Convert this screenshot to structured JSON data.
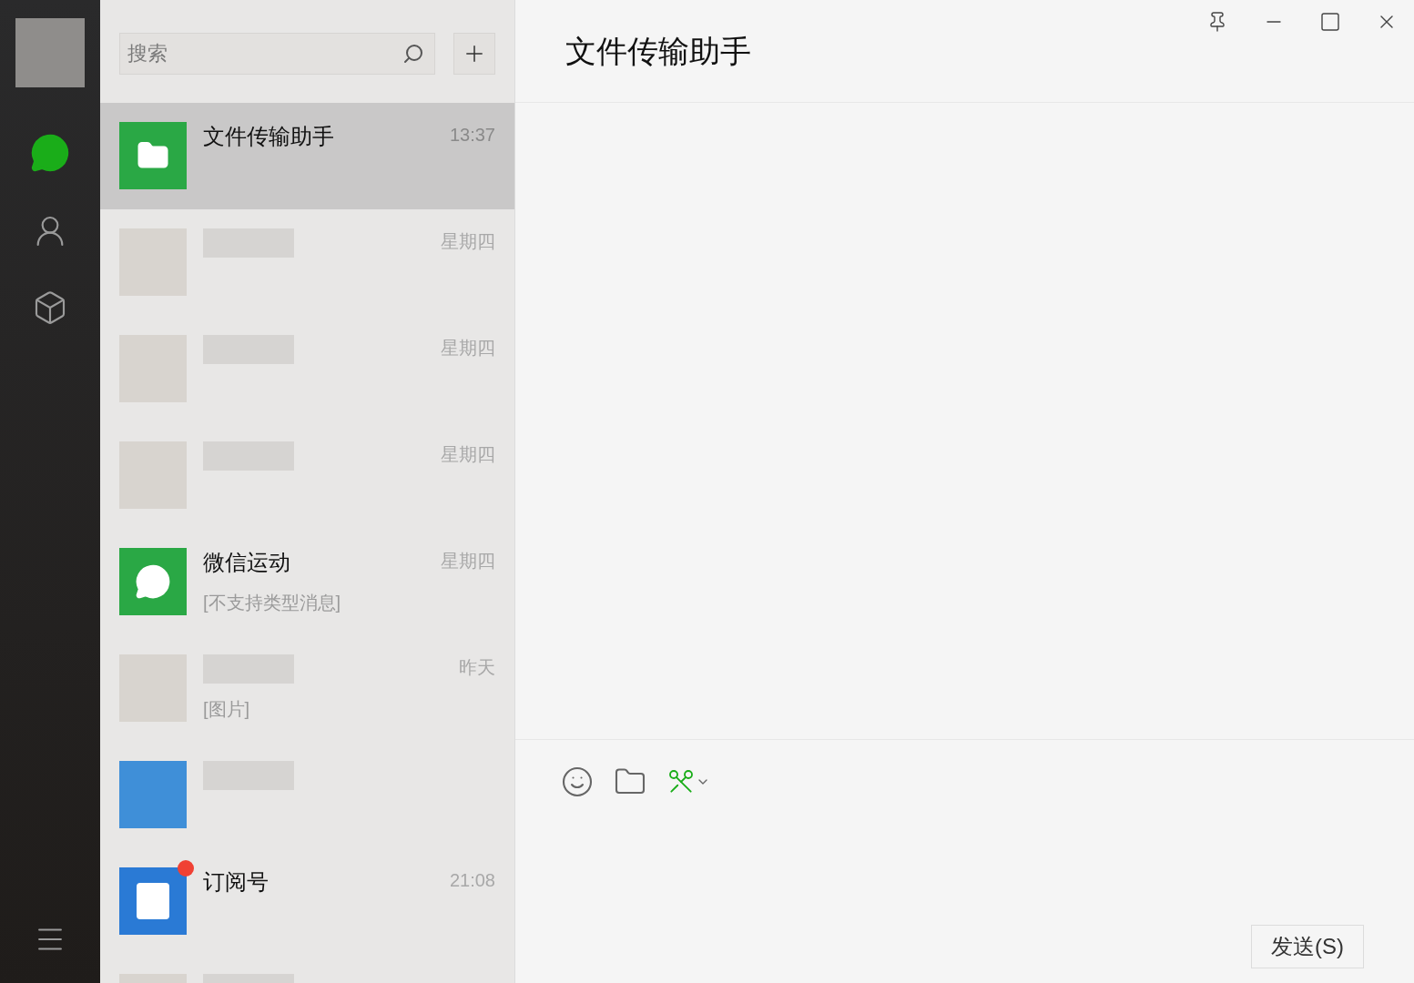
{
  "nav": [
    {
      "kind": "chat",
      "selected": true
    },
    {
      "kind": "contacts",
      "selected": false
    },
    {
      "kind": "box",
      "selected": false
    }
  ],
  "search": {
    "placeholder": "搜索"
  },
  "chats": [
    {
      "kind": "file",
      "name": "文件传输助手",
      "time": "13:37",
      "selected": true,
      "unread": false
    },
    {
      "kind": "photo",
      "time": "星期四",
      "selected": false,
      "unread": false
    },
    {
      "kind": "photo",
      "time": "星期四",
      "selected": false,
      "unread": false
    },
    {
      "kind": "photo",
      "time": "星期四",
      "selected": false,
      "unread": false
    },
    {
      "kind": "wechat",
      "name": "微信运动",
      "preview": "[不支持类型消息]",
      "time": "星期四",
      "selected": false,
      "unread": false
    },
    {
      "kind": "photo",
      "preview": "[图片]",
      "time": "昨天",
      "selected": false,
      "unread": false
    },
    {
      "kind": "blue",
      "selected": false,
      "unread": false
    },
    {
      "kind": "subscription",
      "name": "订阅号",
      "time": "21:08",
      "selected": false,
      "unread": true
    },
    {
      "kind": "photo",
      "selected": false,
      "unread": false
    }
  ],
  "conversation": {
    "title": "文件传输助手"
  },
  "send_button": "发送(S)"
}
